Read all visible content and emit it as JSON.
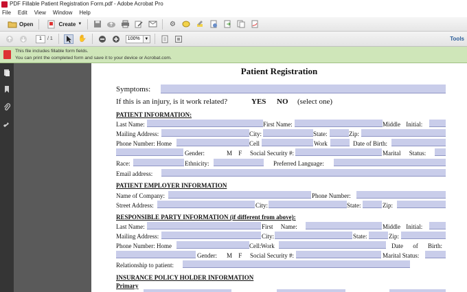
{
  "window": {
    "title": "PDF Fillable Patient Registration Form.pdf - Adobe Acrobat Pro"
  },
  "menu": [
    "File",
    "Edit",
    "View",
    "Window",
    "Help"
  ],
  "toolbar": {
    "open_label": "Open",
    "create_label": "Create",
    "tools_label": "Tools"
  },
  "nav": {
    "page_current": "1",
    "page_total": "/ 1",
    "zoom": "100%"
  },
  "notice": {
    "line1": "This file includes fillable form fields.",
    "line2": "You can print the completed form and save it to your device or Acrobat.com."
  },
  "form": {
    "title": "Patient Registration",
    "symptoms": "Symptoms:",
    "work_related": "If this is an injury, is it work related?",
    "yes": "YES",
    "no": "NO",
    "select_one": "(select one)",
    "sec_patient": "PATIENT INFORMATION:",
    "last_name": "Last Name:",
    "first_name": "First Name:",
    "middle_initial": "Middle Initial:",
    "mailing_address": "Mailing Address:",
    "city": "City:",
    "state": "State:",
    "zip": "Zip:",
    "phone_home": "Phone Number: Home",
    "cell": "Cell",
    "work": "Work",
    "dob": "Date of Birth:",
    "gender": "Gender:",
    "gender_mf": "M  F",
    "ssn": "Social Security #:",
    "marital": "Marital Status:",
    "race": "Race:",
    "ethnicity": "Ethnicity:",
    "pref_lang": "Preferred Language:",
    "email": "Email address:",
    "sec_employer": "PATIENT EMPLOYER INFORMATION",
    "company": "Name of Company:",
    "phone_number": "Phone Number:",
    "street": "Street Address:",
    "emp_city": "City:",
    "emp_state": "State:",
    "emp_zip": "Zip:",
    "sec_responsible": "RESPONSIBLE PARTY INFORMATION (if different from above):",
    "r_last": "Last Name:",
    "r_first": "First Name:",
    "r_middle": "Middle Initial:",
    "r_mailing": "Mailing Address:",
    "r_city": "City:",
    "r_state": "State:",
    "r_zip": "Zip:",
    "r_phone": "Phone Number: Home",
    "r_cell": "Cell:",
    "r_work": "Work",
    "r_dob": "Date of Birth:",
    "r_gender": "Gender:",
    "r_gender_mf": "M  F",
    "r_ssn": "Social Security #:",
    "r_marital": "Marital Status:",
    "relationship": "Relationship to patient:",
    "sec_insurance": "INSURANCE POLICY HOLDER INFORMATION",
    "primary": "Primary"
  }
}
